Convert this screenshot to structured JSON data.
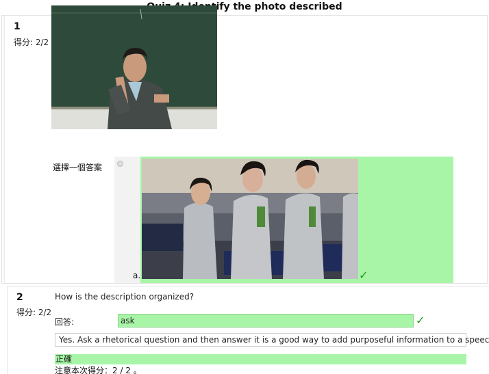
{
  "quiz": {
    "title": "Quiz 4: Identify the photo described"
  },
  "question1": {
    "number": "1",
    "score": "得分: 2/2",
    "prompt_label": "選擇一個答案",
    "options": [
      {
        "letter": "a.",
        "correct": true
      }
    ],
    "check_icon": "checkmark-icon"
  },
  "question2": {
    "number": "2",
    "score": "得分: 2/2",
    "text": "How is the description organized?",
    "answer_label": "回答:",
    "answer_value": "ask",
    "feedback": "Yes. Ask a rhetorical question and then answer it is a good way to add purposeful information to a speech.",
    "correct_label": "正確",
    "score_note": "注意本次得分：2 / 2 。"
  },
  "colors": {
    "correct_bg": "#a8f5a8",
    "check": "#1a9a1a"
  }
}
